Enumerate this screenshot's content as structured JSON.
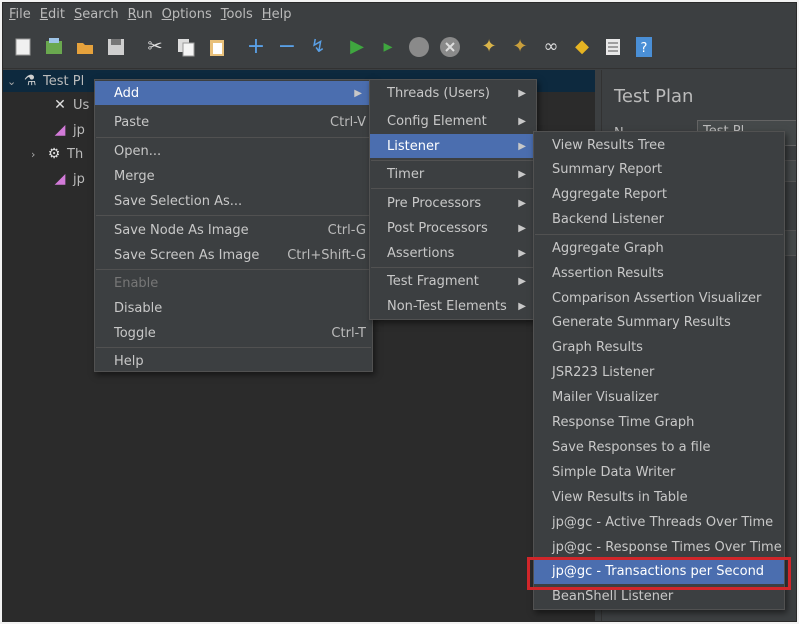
{
  "menubar": {
    "items": [
      {
        "first": "F",
        "rest": "ile"
      },
      {
        "first": "E",
        "rest": "dit"
      },
      {
        "first": "S",
        "rest": "earch"
      },
      {
        "first": "R",
        "rest": "un"
      },
      {
        "first": "O",
        "rest": "ptions"
      },
      {
        "first": "T",
        "rest": "ools"
      },
      {
        "first": "H",
        "rest": "elp"
      }
    ]
  },
  "toolbar": {
    "icons": [
      "new-icon",
      "templates-icon",
      "open-icon",
      "save-icon",
      "cut-icon",
      "copy-icon",
      "paste-icon",
      "expand-icon",
      "collapse-icon",
      "toggle-icon",
      "start-icon",
      "start-no-pauses-icon",
      "stop-icon",
      "shutdown-icon",
      "clear-icon",
      "clear-all-icon",
      "search-icon",
      "reset-search-icon",
      "function-helper-icon",
      "help-icon"
    ]
  },
  "tree": {
    "root_label": "Test Pl",
    "child1": "Us",
    "child2": "jp",
    "child3": "Th",
    "child4": "jp"
  },
  "right_panel": {
    "title": "Test Plan",
    "name_label": "N",
    "name_value": "Test Pl"
  },
  "context_menu": {
    "add": "Add",
    "paste": "Paste",
    "paste_accel": "Ctrl-V",
    "open": "Open...",
    "merge": "Merge",
    "save_selection": "Save Selection As...",
    "save_node_image": "Save Node As Image",
    "save_node_image_accel": "Ctrl-G",
    "save_screen_image": "Save Screen As Image",
    "save_screen_image_accel": "Ctrl+Shift-G",
    "enable": "Enable",
    "disable": "Disable",
    "toggle": "Toggle",
    "toggle_accel": "Ctrl-T",
    "help": "Help"
  },
  "add_menu": {
    "threads": "Threads (Users)",
    "config": "Config Element",
    "listener": "Listener",
    "timer": "Timer",
    "pre": "Pre Processors",
    "post": "Post Processors",
    "assertions": "Assertions",
    "fragment": "Test Fragment",
    "non_test": "Non-Test Elements"
  },
  "listener_menu": {
    "items_top": [
      "View Results Tree",
      "Summary Report",
      "Aggregate Report",
      "Backend Listener"
    ],
    "items_bottom": [
      "Aggregate Graph",
      "Assertion Results",
      "Comparison Assertion Visualizer",
      "Generate Summary Results",
      "Graph Results",
      "JSR223 Listener",
      "Mailer Visualizer",
      "Response Time Graph",
      "Save Responses to a file",
      "Simple Data Writer",
      "View Results in Table",
      "jp@gc - Active Threads Over Time",
      "jp@gc - Response Times Over Time",
      "jp@gc - Transactions per Second",
      "BeanShell Listener"
    ],
    "highlighted": "jp@gc - Transactions per Second"
  },
  "colors": {
    "menu_bg": "#3c3f41",
    "highlight": "#4b6eaf",
    "annotation_box": "#d0262a"
  }
}
